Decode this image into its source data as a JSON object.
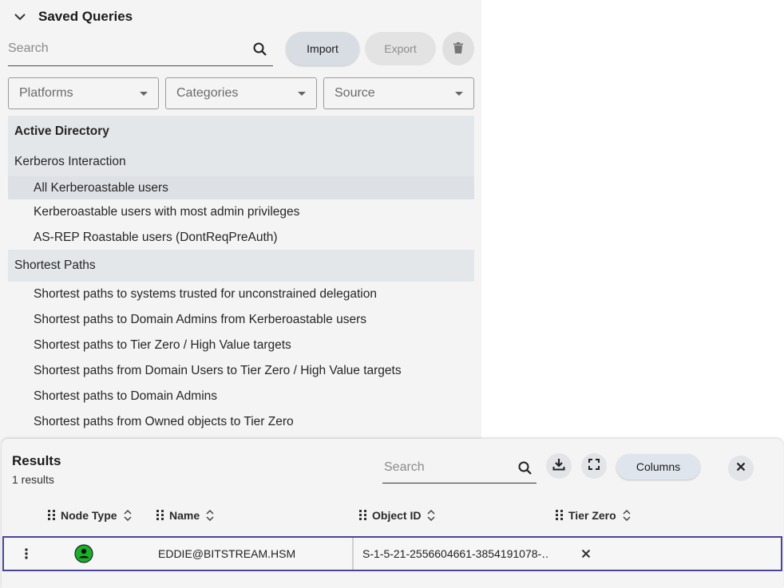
{
  "saved_queries": {
    "title": "Saved Queries",
    "search_placeholder": "Search",
    "import_label": "Import",
    "export_label": "Export",
    "filters": {
      "platforms": "Platforms",
      "categories": "Categories",
      "source": "Source"
    },
    "list": [
      {
        "label": "Active Directory",
        "kind": "group",
        "bold": true
      },
      {
        "label": "Kerberos Interaction",
        "kind": "sub"
      },
      {
        "label": "All Kerberoastable users",
        "kind": "item",
        "selected": true
      },
      {
        "label": "Kerberoastable users with most admin privileges",
        "kind": "item"
      },
      {
        "label": "AS-REP Roastable users (DontReqPreAuth)",
        "kind": "item"
      },
      {
        "label": "Shortest Paths",
        "kind": "group"
      },
      {
        "label": "Shortest paths to systems trusted for unconstrained delegation",
        "kind": "item"
      },
      {
        "label": "Shortest paths to Domain Admins from Kerberoastable users",
        "kind": "item"
      },
      {
        "label": "Shortest paths to Tier Zero / High Value targets",
        "kind": "item"
      },
      {
        "label": "Shortest paths from Domain Users to Tier Zero / High Value targets",
        "kind": "item"
      },
      {
        "label": "Shortest paths to Domain Admins",
        "kind": "item"
      },
      {
        "label": "Shortest paths from Owned objects to Tier Zero",
        "kind": "item"
      }
    ]
  },
  "results": {
    "title": "Results",
    "count_text": "1 results",
    "search_placeholder": "Search",
    "columns_label": "Columns",
    "headers": {
      "node_type": "Node Type",
      "name": "Name",
      "object_id": "Object ID",
      "tier_zero": "Tier Zero"
    },
    "rows": [
      {
        "name": "EDDIE@BITSTREAM.HSM",
        "object_id": "S-1-5-21-2556604661-3854191078-…",
        "node_type_icon": "user-icon",
        "tier_zero_icon": "x-icon"
      }
    ]
  },
  "colors": {
    "accent_row_border": "#4a4596",
    "user_node": "#17b22a",
    "panel_bg": "#f4f4f4"
  }
}
